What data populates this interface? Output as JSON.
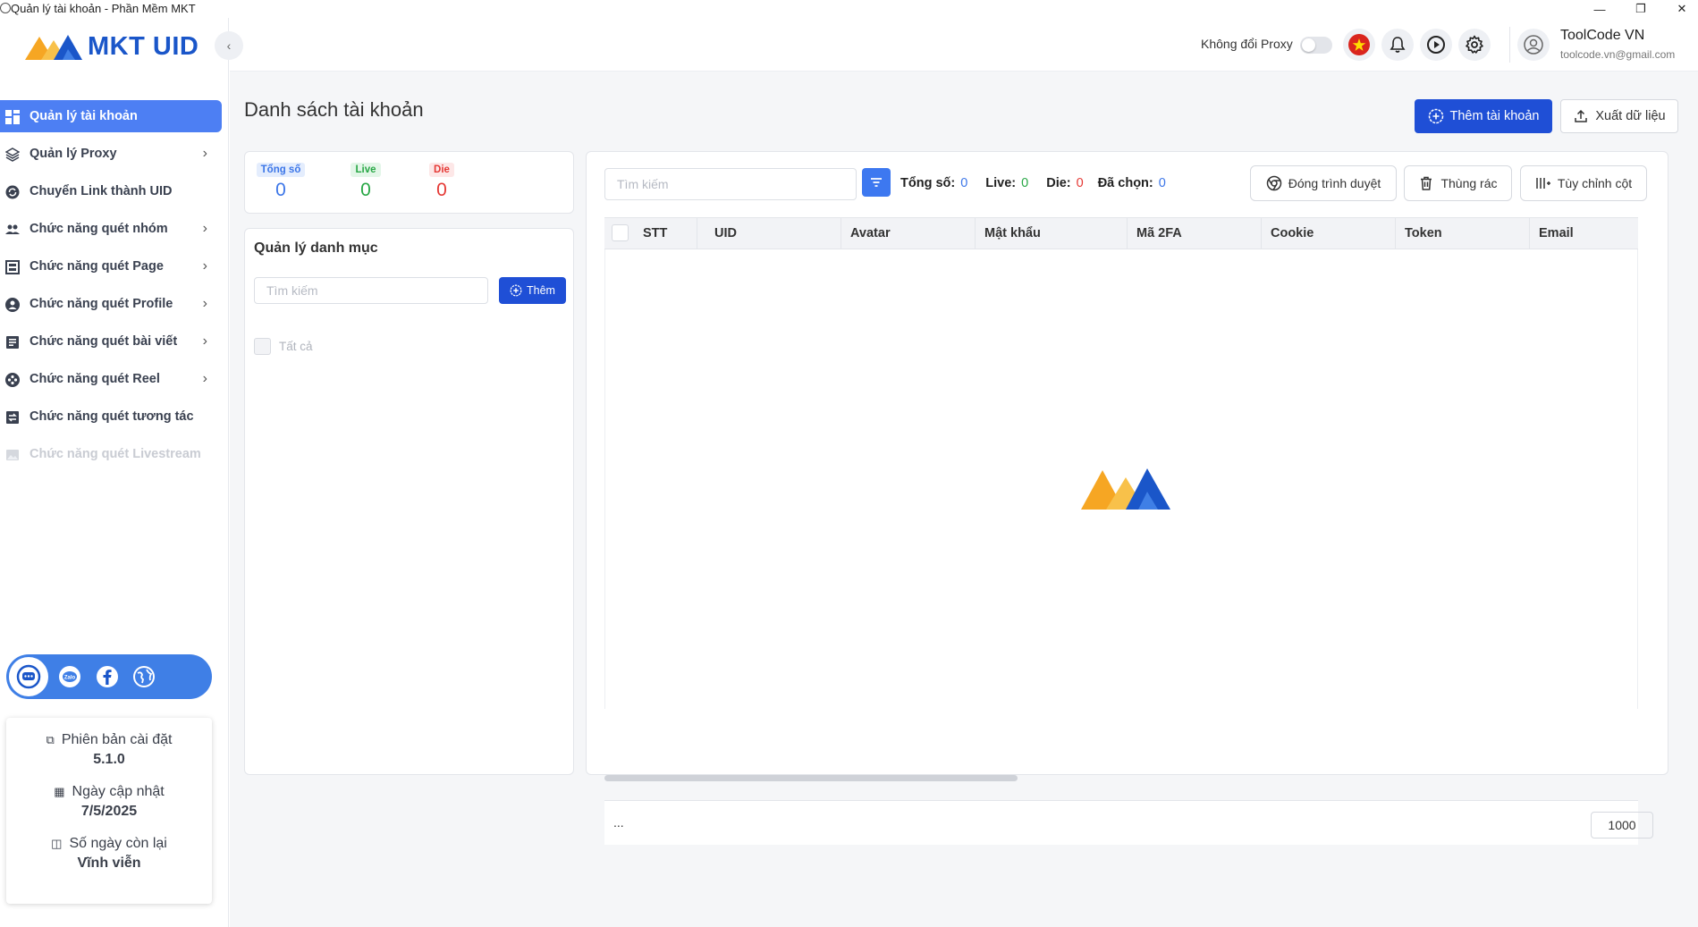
{
  "window": {
    "title": "Quản lý tài khoản - Phần Mềm MKT",
    "controls": {
      "minimize": "—",
      "restore": "❐",
      "close": "✕"
    }
  },
  "brand": {
    "logo_text": "MKT UID",
    "colors": {
      "orange": "#f6a623",
      "blue": "#1a56c9",
      "primary": "#1f4fd6"
    }
  },
  "sidebar": {
    "items": [
      {
        "label": "Quản lý tài khoản",
        "icon": "dashboard-icon",
        "active": true,
        "has_children": false
      },
      {
        "label": "Quản lý Proxy",
        "icon": "layers-icon",
        "has_children": true
      },
      {
        "label": "Chuyển Link thành UID",
        "icon": "refresh-circle-icon",
        "has_children": false
      },
      {
        "label": "Chức năng quét nhóm",
        "icon": "group-icon",
        "has_children": true
      },
      {
        "label": "Chức năng quét Page",
        "icon": "page-icon",
        "has_children": true
      },
      {
        "label": "Chức năng quét Profile",
        "icon": "profile-icon",
        "has_children": true
      },
      {
        "label": "Chức năng quét bài viết",
        "icon": "article-icon",
        "has_children": true
      },
      {
        "label": "Chức năng quét Reel",
        "icon": "reel-icon",
        "has_children": true
      },
      {
        "label": "Chức năng quét tương tác",
        "icon": "interaction-icon",
        "has_children": false
      },
      {
        "label": "Chức năng quét Livestream",
        "icon": "livestream-icon",
        "disabled": true,
        "has_children": false
      }
    ],
    "version": {
      "install_label": "Phiên bản cài đặt",
      "install_value": "5.1.0",
      "update_label": "Ngày cập nhật",
      "update_value": "7/5/2025",
      "remaining_label": "Số ngày còn lại",
      "remaining_value": "Vĩnh viễn"
    }
  },
  "header": {
    "proxy_label": "Không đổi Proxy",
    "proxy_enabled": false,
    "user_name": "ToolCode VN",
    "user_email": "toolcode.vn@gmail.com"
  },
  "page": {
    "title": "Danh sách tài khoản",
    "add_account": "Thêm tài khoản",
    "export_data": "Xuất dữ liệu"
  },
  "stats": {
    "total_label": "Tổng số",
    "total_value": "0",
    "live_label": "Live",
    "live_value": "0",
    "die_label": "Die",
    "die_value": "0"
  },
  "category": {
    "title": "Quản lý danh mục",
    "search_placeholder": "Tìm kiếm",
    "add_label": "Thêm",
    "all_label": "Tất cả"
  },
  "toolbar": {
    "search_placeholder": "Tìm kiếm",
    "total_label": "Tổng số:",
    "total_value": "0",
    "live_label": "Live:",
    "live_value": "0",
    "die_label": "Die:",
    "die_value": "0",
    "selected_label": "Đã chọn:",
    "selected_value": "0",
    "close_browser": "Đóng trình duyệt",
    "trash": "Thùng rác",
    "customize_columns": "Tùy chỉnh cột"
  },
  "table": {
    "columns": [
      "STT",
      "UID",
      "Avatar",
      "Mật khẩu",
      "Mã 2FA",
      "Cookie",
      "Token",
      "Email"
    ],
    "rows": [],
    "footer_text": "...",
    "page_size": "1000"
  }
}
